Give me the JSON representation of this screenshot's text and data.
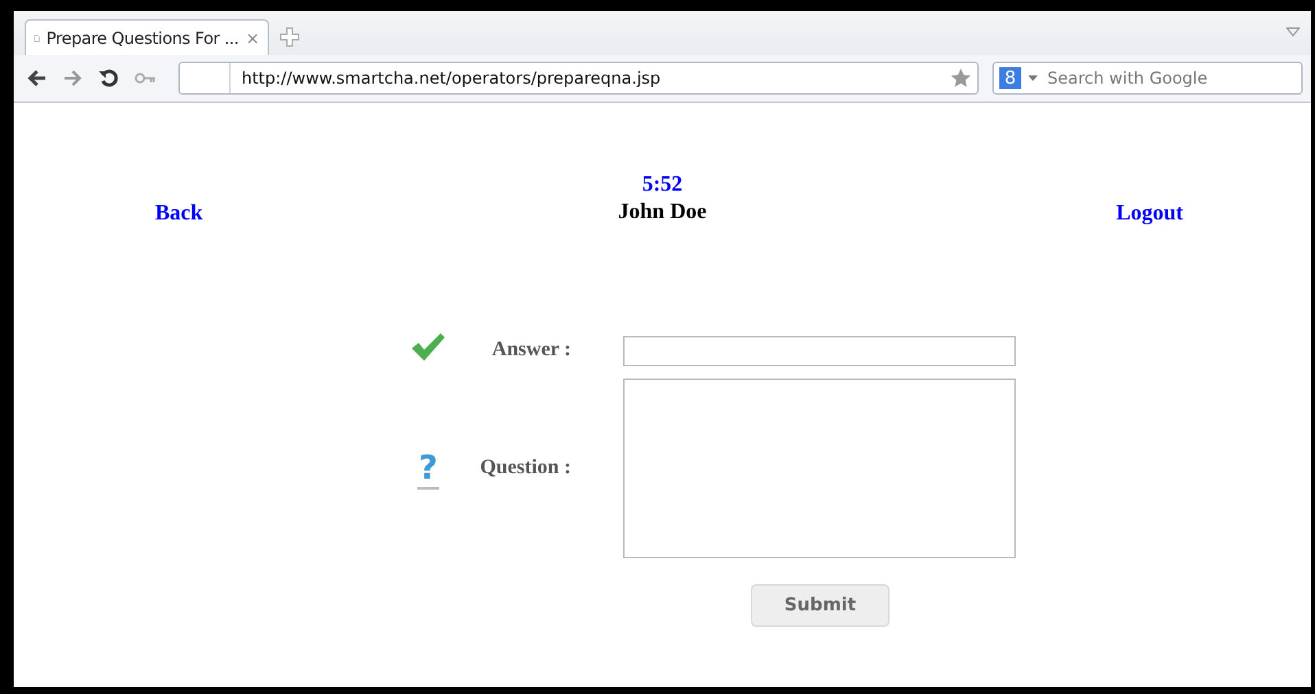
{
  "browser": {
    "tab_title": "Prepare Questions For ...",
    "tab_close": "×",
    "address": "http://www.smartcha.net/operators/prepareqna.jsp",
    "search_placeholder": "Search with Google",
    "search_engine_glyph": "8"
  },
  "header": {
    "back": "Back",
    "timer": "5:52",
    "user": "John Doe",
    "logout": "Logout"
  },
  "form": {
    "answer_label": "Answer :",
    "answer_accepted": true,
    "question_label": "Question :",
    "question_glyph": "?",
    "submit": "Submit"
  }
}
